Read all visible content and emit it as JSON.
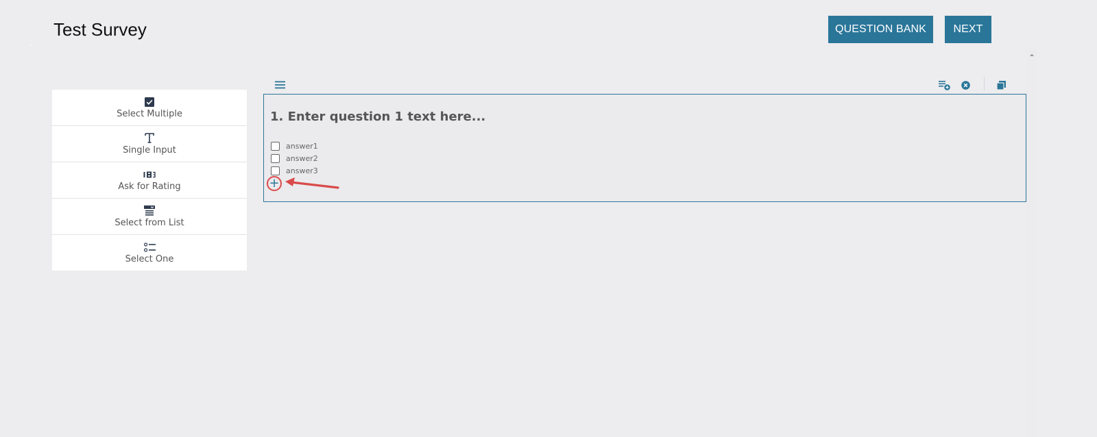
{
  "header": {
    "title": "Test Survey",
    "question_bank_label": "QUESTION BANK",
    "next_label": "NEXT"
  },
  "palette": {
    "items": [
      {
        "label": "Select Multiple",
        "icon": "checkbox-icon"
      },
      {
        "label": "Single Input",
        "icon": "text-t-icon"
      },
      {
        "label": "Ask for Rating",
        "icon": "rating-123-icon"
      },
      {
        "label": "Select from List",
        "icon": "dropdown-list-icon"
      },
      {
        "label": "Select One",
        "icon": "radio-list-icon"
      }
    ]
  },
  "question": {
    "title": "1. Enter question 1 text here...",
    "answers": [
      "answer1",
      "answer2",
      "answer3"
    ],
    "add_symbol": "+"
  },
  "toolbar": {
    "icons": [
      "drag-menu-icon",
      "add-question-icon",
      "delete-icon",
      "duplicate-icon"
    ]
  },
  "colors": {
    "accent": "#2a7699",
    "background": "#edecee",
    "annotation": "#d94a4a"
  }
}
